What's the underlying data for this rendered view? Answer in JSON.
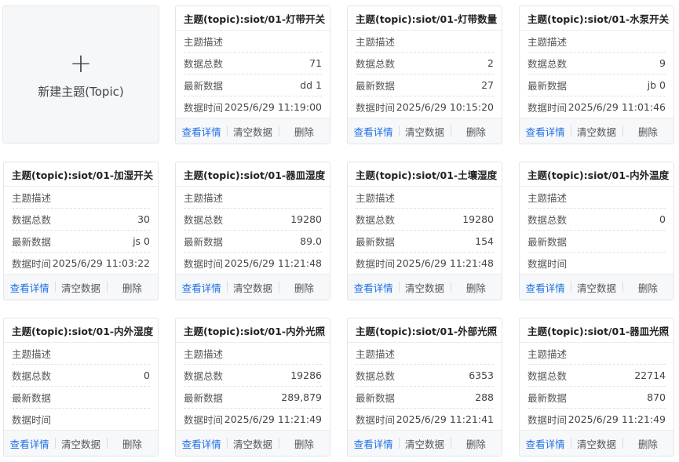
{
  "new_topic": {
    "plus_icon": "+",
    "label": "新建主题(Topic)"
  },
  "labels": {
    "topic_prefix": "主题(topic):",
    "desc": "主题描述",
    "count": "数据总数",
    "latest": "最新数据",
    "time": "数据时间",
    "view": "查看详情",
    "clear": "清空数据",
    "delete": "删除"
  },
  "cards": [
    {
      "topic": "siot/01-灯带开关",
      "desc": "",
      "count": "71",
      "latest": "dd 1",
      "time": "2025/6/29 11:19:00"
    },
    {
      "topic": "siot/01-灯带数量",
      "desc": "",
      "count": "2",
      "latest": "27",
      "time": "2025/6/29 10:15:20"
    },
    {
      "topic": "siot/01-水泵开关",
      "desc": "",
      "count": "9",
      "latest": "jb 0",
      "time": "2025/6/29 11:01:46"
    },
    {
      "topic": "siot/01-加湿开关",
      "desc": "",
      "count": "30",
      "latest": "js 0",
      "time": "2025/6/29 11:03:22"
    },
    {
      "topic": "siot/01-器皿湿度",
      "desc": "",
      "count": "19280",
      "latest": "89.0",
      "time": "2025/6/29 11:21:48"
    },
    {
      "topic": "siot/01-土壤湿度",
      "desc": "",
      "count": "19280",
      "latest": "154",
      "time": "2025/6/29 11:21:48"
    },
    {
      "topic": "siot/01-内外温度",
      "desc": "",
      "count": "0",
      "latest": "",
      "time": ""
    },
    {
      "topic": "siot/01-内外湿度",
      "desc": "",
      "count": "0",
      "latest": "",
      "time": ""
    },
    {
      "topic": "siot/01-内外光照",
      "desc": "",
      "count": "19286",
      "latest": "289,879",
      "time": "2025/6/29 11:21:49"
    },
    {
      "topic": "siot/01-外部光照",
      "desc": "",
      "count": "6353",
      "latest": "288",
      "time": "2025/6/29 11:21:41"
    },
    {
      "topic": "siot/01-器皿光照",
      "desc": "",
      "count": "22714",
      "latest": "870",
      "time": "2025/6/29 11:21:49"
    }
  ]
}
